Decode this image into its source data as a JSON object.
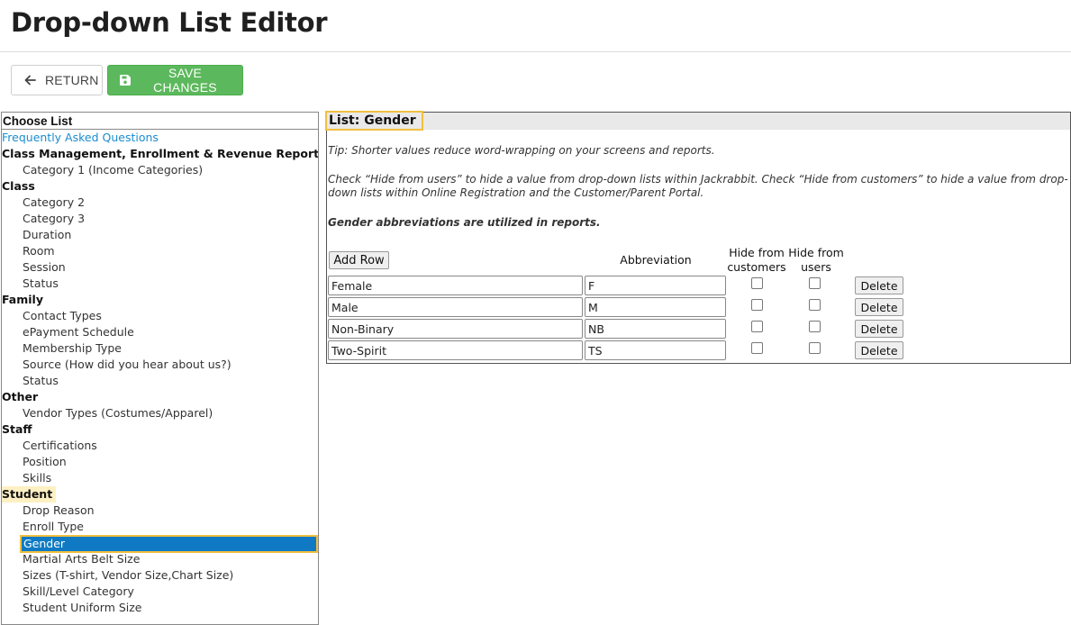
{
  "page": {
    "title": "Drop-down List Editor"
  },
  "toolbar": {
    "return_label": "RETURN",
    "save_label": "SAVE CHANGES",
    "save_color": "#5cb85c"
  },
  "choose_list": {
    "header": "Choose List",
    "rows": [
      {
        "type": "link",
        "label": "Frequently Asked Questions"
      },
      {
        "type": "group",
        "label": "Class Management, Enrollment & Revenue Reporting"
      },
      {
        "type": "item",
        "label": "Category 1 (Income Categories)"
      },
      {
        "type": "group",
        "label": "Class"
      },
      {
        "type": "item",
        "label": "Category 2"
      },
      {
        "type": "item",
        "label": "Category 3"
      },
      {
        "type": "item",
        "label": "Duration"
      },
      {
        "type": "item",
        "label": "Room"
      },
      {
        "type": "item",
        "label": "Session"
      },
      {
        "type": "item",
        "label": "Status"
      },
      {
        "type": "group",
        "label": "Family"
      },
      {
        "type": "item",
        "label": "Contact Types"
      },
      {
        "type": "item",
        "label": "ePayment Schedule"
      },
      {
        "type": "item",
        "label": "Membership Type"
      },
      {
        "type": "item",
        "label": "Source (How did you hear about us?)"
      },
      {
        "type": "item",
        "label": "Status"
      },
      {
        "type": "group",
        "label": "Other"
      },
      {
        "type": "item",
        "label": "Vendor Types (Costumes/Apparel)"
      },
      {
        "type": "group",
        "label": "Staff"
      },
      {
        "type": "item",
        "label": "Certifications"
      },
      {
        "type": "item",
        "label": "Position"
      },
      {
        "type": "item",
        "label": "Skills"
      },
      {
        "type": "group",
        "label": "Student",
        "highlight": true
      },
      {
        "type": "item",
        "label": "Drop Reason"
      },
      {
        "type": "item",
        "label": "Enroll Type"
      },
      {
        "type": "item",
        "label": "Gender",
        "selected": true
      },
      {
        "type": "item",
        "label": "Martial Arts Belt Size"
      },
      {
        "type": "item",
        "label": "Sizes (T-shirt, Vendor Size,Chart Size)"
      },
      {
        "type": "item",
        "label": "Skill/Level Category"
      },
      {
        "type": "item",
        "label": "Student Uniform Size"
      }
    ]
  },
  "editor": {
    "title": "List: Gender",
    "tip": "Tip: Shorter values reduce word-wrapping on your screens and reports.",
    "hide_note": "Check “Hide from users” to hide a value from drop-down lists within Jackrabbit. Check “Hide from customers” to hide a value from drop-down lists within Online Registration and the Customer/Parent Portal.",
    "abbrev_note": "Gender abbreviations are utilized in reports.",
    "add_row_label": "Add Row",
    "col_abbreviation": "Abbreviation",
    "col_hide_customers": "Hide from customers",
    "col_hide_users": "Hide from users",
    "delete_label": "Delete",
    "rows": [
      {
        "value": "Female",
        "abbreviation": "F",
        "hide_customers": false,
        "hide_users": false
      },
      {
        "value": "Male",
        "abbreviation": "M",
        "hide_customers": false,
        "hide_users": false
      },
      {
        "value": "Non-Binary",
        "abbreviation": "NB",
        "hide_customers": false,
        "hide_users": false
      },
      {
        "value": "Two-Spirit",
        "abbreviation": "TS",
        "hide_customers": false,
        "hide_users": false
      }
    ]
  }
}
